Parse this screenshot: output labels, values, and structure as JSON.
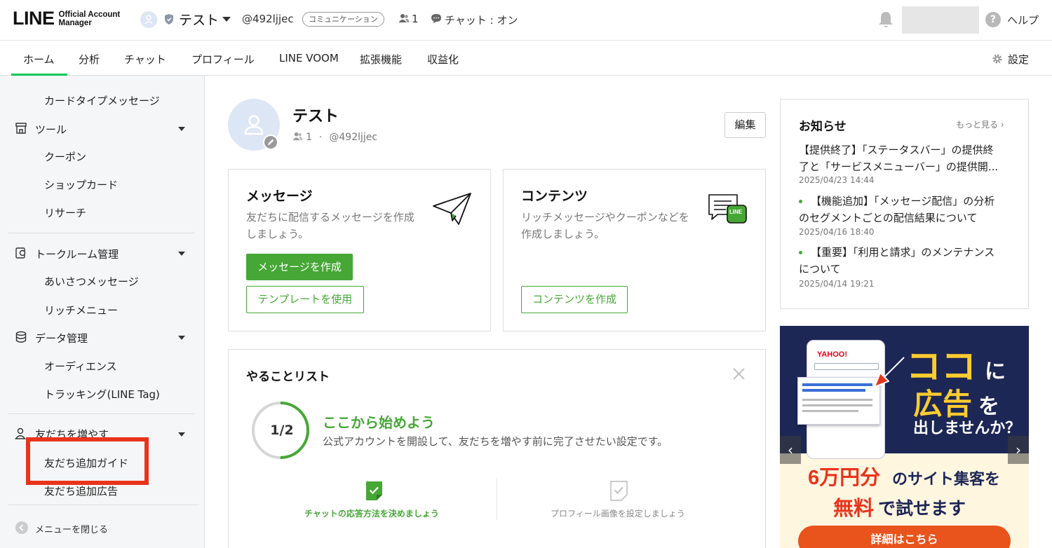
{
  "brand": {
    "logo": "LINE",
    "logo_sub_1": "Official Account",
    "logo_sub_2": "Manager"
  },
  "account": {
    "name": "テスト",
    "id": "@492ljjec",
    "plan": "コミュニケーション",
    "friends": "1",
    "chat_status": "チャット : オン"
  },
  "header": {
    "help": "ヘルプ"
  },
  "tabs": [
    {
      "label": "ホーム",
      "active": true
    },
    {
      "label": "分析"
    },
    {
      "label": "チャット"
    },
    {
      "label": "プロフィール"
    },
    {
      "label": "LINE VOOM"
    },
    {
      "label": "拡張機能"
    },
    {
      "label": "収益化"
    }
  ],
  "settings": {
    "label": "設定"
  },
  "sidebar": {
    "card_type": "カードタイプメッセージ",
    "tools": {
      "label": "ツール",
      "items": [
        "クーポン",
        "ショップカード",
        "リサーチ"
      ]
    },
    "talkroom": {
      "label": "トークルーム管理",
      "items": [
        "あいさつメッセージ",
        "リッチメニュー"
      ]
    },
    "data": {
      "label": "データ管理",
      "items": [
        "オーディエンス",
        "トラッキング(LINE Tag)"
      ]
    },
    "friends": {
      "label": "友だちを増やす",
      "items": [
        "友だち追加ガイド",
        "友だち追加広告"
      ]
    },
    "close": "メニューを閉じる"
  },
  "profile": {
    "name": "テスト",
    "friends": "1",
    "id": "@492ljjec",
    "edit": "編集"
  },
  "message_card": {
    "title": "メッセージ",
    "desc_1": "友だちに配信するメッセージを作成",
    "desc_2": "しましょう。",
    "primary": "メッセージを作成",
    "secondary": "テンプレートを使用"
  },
  "content_card": {
    "title": "コンテンツ",
    "desc_1": "リッチメッセージやクーポンなどを",
    "desc_2": "作成しましょう。",
    "button": "コンテンツを作成",
    "icon_text": "LINE"
  },
  "todo": {
    "title": "やることリスト",
    "progress": "1/2",
    "progress_fraction": 0.5,
    "heading": "ここから始めよう",
    "subtext": "公式アカウントを開設して、友だちを増やす前に完了させたい設定です。",
    "steps": [
      {
        "label": "チャットの応答方法を決めましょう",
        "done": true
      },
      {
        "label": "プロフィール画像を設定しましょう",
        "done": false
      }
    ]
  },
  "news": {
    "title": "お知らせ",
    "more": "もっと見る",
    "items": [
      {
        "line1": "【提供終了】「ステータスバー」の提供終",
        "line2": "了と「サービスメニューバー」の提供開...",
        "date": "2025/04/23 14:44"
      },
      {
        "line1": "【機能追加】「メッセージ配信」の分析",
        "line2": "のセグメントごとの配信結果について",
        "date": "2025/04/16 18:40"
      },
      {
        "line1": "【重要】「利用と請求」のメンテナンス",
        "line2": "について",
        "date": "2025/04/14 19:21"
      }
    ]
  },
  "banner": {
    "big_1": "ココ",
    "small_1": "に",
    "big_2": "広告",
    "small_2": "を",
    "line3": "出しませんか？",
    "offer_1": "6万円分",
    "offer_2": "のサイト集客を",
    "offer_3": "無料",
    "offer_4": "で試せます",
    "cta": "詳細はこちら",
    "phone_brand": "YAHOO!"
  },
  "colors": {
    "green": "#06c755",
    "button_green": "#46a736",
    "highlight": "#e8341c"
  }
}
